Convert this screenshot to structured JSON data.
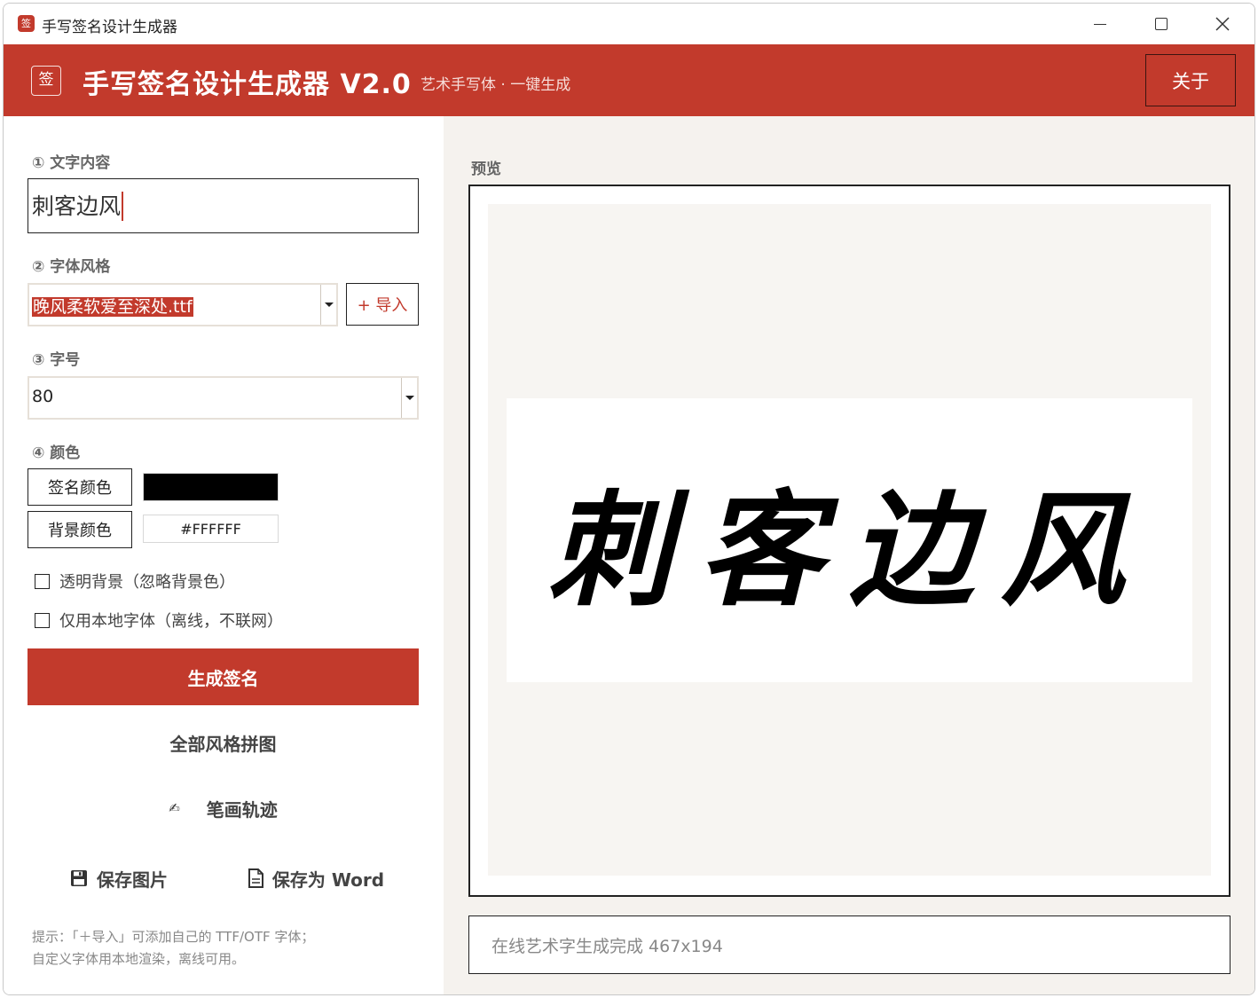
{
  "window": {
    "title": "手写签名设计生成器",
    "app_icon": "签"
  },
  "header": {
    "badge": "签",
    "title": "手写签名设计生成器  V2.0",
    "subtitle": "艺术手写体 · 一键生成",
    "about_label": "关于",
    "color": "#c23a2c"
  },
  "form": {
    "text_label": "① 文字内容",
    "text_value": "刺客边风",
    "font_label": "② 字体风格",
    "font_value": "晚风柔软爱至深处.ttf",
    "import_label": "+ 导入",
    "size_label": "③ 字号",
    "size_value": "80",
    "color_label": "④ 颜色",
    "sig_color_label": "签名颜色",
    "sig_color_value": "#000000",
    "bg_color_label": "背景颜色",
    "bg_color_value": "#FFFFFF",
    "transparent_label": "透明背景（忽略背景色）",
    "transparent_checked": false,
    "local_font_label": "仅用本地字体（离线，不联网）",
    "local_font_checked": false
  },
  "actions": {
    "generate": "生成签名",
    "all_styles": "全部风格拼图",
    "stroke_icon": "signature-icon",
    "stroke": "笔画轨迹",
    "save_image_icon": "floppy-disk-icon",
    "save_image": "保存图片",
    "save_word_icon": "document-icon",
    "save_word": "保存为 Word"
  },
  "hint": {
    "line1": "提示：「＋导入」可添加自己的 TTF/OTF 字体；",
    "line2": "自定义字体用本地渲染，离线可用。"
  },
  "preview": {
    "label": "预览",
    "signature": "刺客边风",
    "status": "在线艺术字生成完成 467x194"
  }
}
